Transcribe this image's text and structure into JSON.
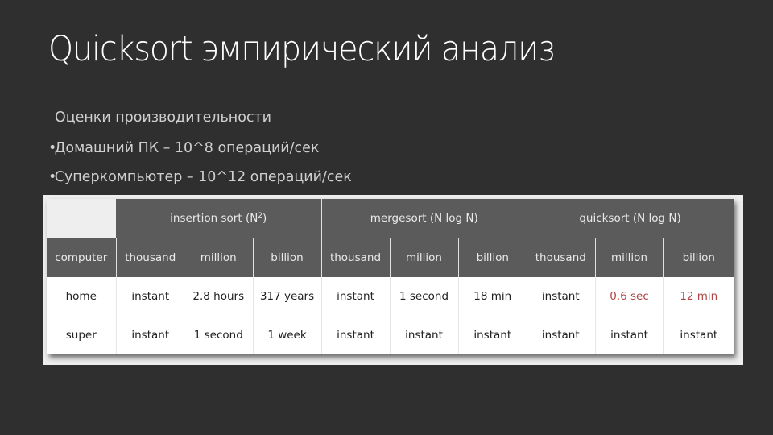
{
  "slide": {
    "title": "Quicksort эмпирический анализ",
    "subtitle": "Оценки производительности",
    "bullets": [
      {
        "marker": "•",
        "text": "Домашний ПК – 10^8 операций/сек"
      },
      {
        "marker": "•",
        "text": "Суперкомпьютер – 10^12 операций/сек"
      }
    ]
  },
  "table": {
    "groups": [
      {
        "label": "insertion sort (N",
        "sup": "2",
        "suffix": ")"
      },
      {
        "label": "mergesort (N log N)"
      },
      {
        "label": "quicksort (N log N)"
      }
    ],
    "columns": [
      "computer",
      "thousand",
      "million",
      "billion",
      "thousand",
      "million",
      "billion",
      "thousand",
      "million",
      "billion"
    ],
    "rows": [
      {
        "computer": "home",
        "cells": [
          "instant",
          "2.8 hours",
          "317 years",
          "instant",
          "1 second",
          "18 min",
          "instant",
          "0.6 sec",
          "12 min"
        ]
      },
      {
        "computer": "super",
        "cells": [
          "instant",
          "1 second",
          "1 week",
          "instant",
          "instant",
          "instant",
          "instant",
          "instant",
          "instant"
        ]
      }
    ],
    "highlight_color": "#b04545"
  }
}
